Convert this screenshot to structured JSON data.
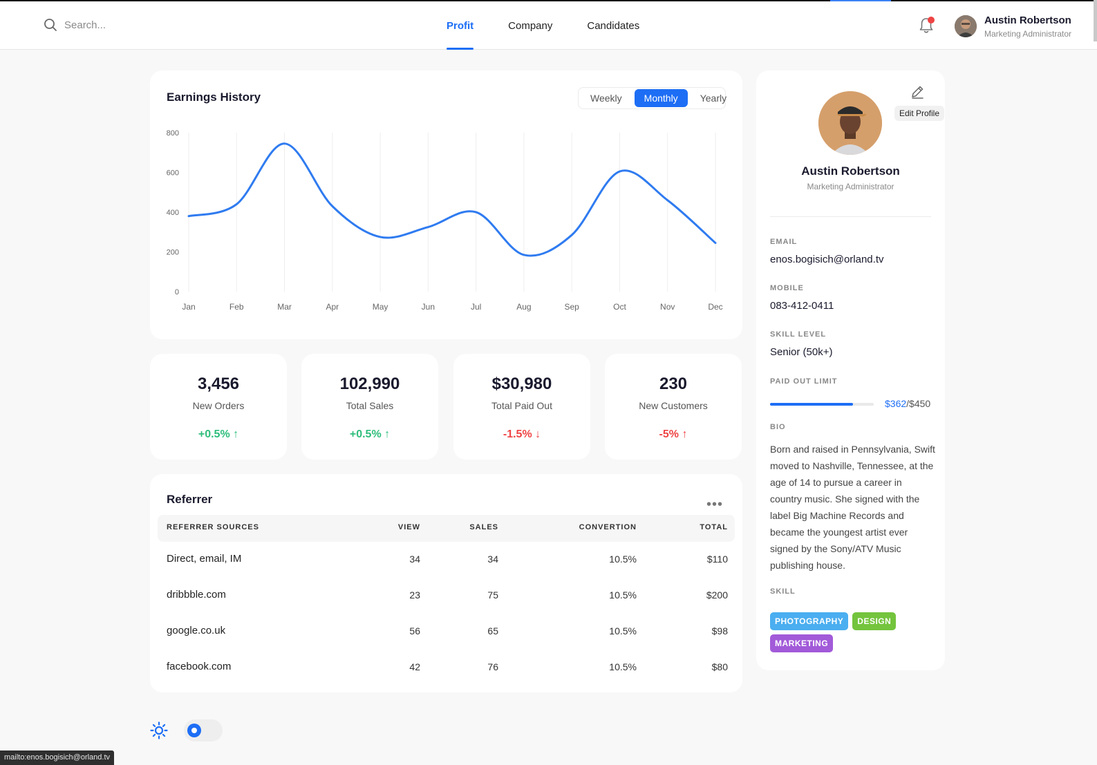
{
  "header": {
    "search_placeholder": "Search...",
    "tabs": [
      {
        "label": "Profit",
        "active": true
      },
      {
        "label": "Company",
        "active": false
      },
      {
        "label": "Candidates",
        "active": false
      }
    ],
    "user_name": "Austin Robertson",
    "user_role": "Marketing Administrator"
  },
  "earnings": {
    "title": "Earnings History",
    "periods": [
      {
        "label": "Weekly",
        "active": false
      },
      {
        "label": "Monthly",
        "active": true
      },
      {
        "label": "Yearly",
        "active": false
      }
    ]
  },
  "chart_data": {
    "type": "line",
    "title": "Earnings History",
    "xlabel": "",
    "ylabel": "",
    "categories": [
      "Jan",
      "Feb",
      "Mar",
      "Apr",
      "May",
      "Jun",
      "Jul",
      "Aug",
      "Sep",
      "Oct",
      "Nov",
      "Dec"
    ],
    "y_ticks": [
      0,
      200,
      400,
      600,
      800
    ],
    "ylim": [
      0,
      800
    ],
    "series": [
      {
        "values": [
          380,
          440,
          745,
          430,
          275,
          325,
          400,
          185,
          285,
          605,
          460,
          245
        ]
      }
    ],
    "color": "#2f7bf0",
    "grid": "vertical"
  },
  "stats": [
    {
      "value": "3,456",
      "label": "New Orders",
      "change": "+0.5%",
      "trend": "up",
      "arrow": "↑"
    },
    {
      "value": "102,990",
      "label": "Total Sales",
      "change": "+0.5%",
      "trend": "up",
      "arrow": "↑"
    },
    {
      "value": "$30,980",
      "label": "Total Paid Out",
      "change": "-1.5%",
      "trend": "down",
      "arrow": "↓"
    },
    {
      "value": "230",
      "label": "New Customers",
      "change": "-5%",
      "trend": "down",
      "arrow": "↑"
    }
  ],
  "referrer": {
    "title": "Referrer",
    "more_icon": "more-horizontal-icon",
    "columns": [
      "REFERRER SOURCES",
      "VIEW",
      "SALES",
      "CONVERTION",
      "TOTAL"
    ],
    "rows": [
      {
        "source": "Direct, email, IM",
        "view": "34",
        "sales": "34",
        "conversion": "10.5%",
        "total": "$110"
      },
      {
        "source": "dribbble.com",
        "view": "23",
        "sales": "75",
        "conversion": "10.5%",
        "total": "$200"
      },
      {
        "source": "google.co.uk",
        "view": "56",
        "sales": "65",
        "conversion": "10.5%",
        "total": "$98"
      },
      {
        "source": "facebook.com",
        "view": "42",
        "sales": "76",
        "conversion": "10.5%",
        "total": "$80"
      }
    ]
  },
  "profile": {
    "edit_label": "Edit Profile",
    "name": "Austin Robertson",
    "role": "Marketing Administrator",
    "email_label": "EMAIL",
    "email": "enos.bogisich@orland.tv",
    "mobile_label": "MOBILE",
    "mobile": "083-412-0411",
    "skill_level_label": "SKILL LEVEL",
    "skill_level": "Senior (50k+)",
    "paid_out_label": "PAID OUT LIMIT",
    "paid_out_used": "$362",
    "paid_out_max": "/$450",
    "paid_out_fraction": 0.8,
    "bio_label": "BIO",
    "bio": "Born and raised in Pennsylvania, Swift moved to Nashville, Tennessee, at the age of 14 to pursue a career in country music. She signed with the label Big Machine Records and became the youngest artist ever signed by the Sony/ATV Music publishing house.",
    "skill_label": "SKILL",
    "skills": [
      {
        "label": "PHOTOGRAPHY",
        "color": "#4aaef0"
      },
      {
        "label": "DESIGN",
        "color": "#74c43d"
      },
      {
        "label": "MARKETING",
        "color": "#a25ad9"
      }
    ]
  },
  "status_bar": "mailto:enos.bogisich@orland.tv"
}
